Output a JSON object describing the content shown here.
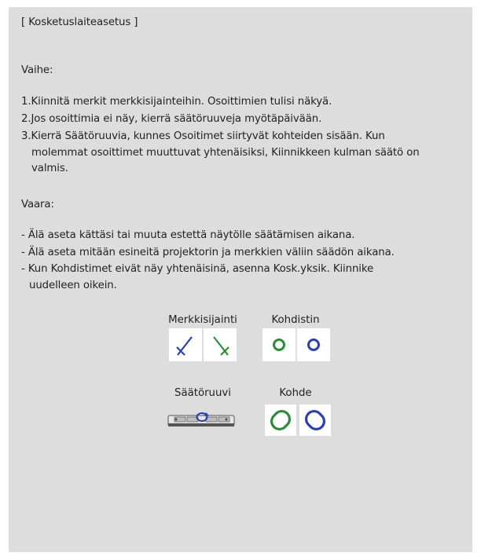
{
  "dialog": {
    "title": "[ Kosketuslaiteasetus ]",
    "steps_heading": "Vaihe:",
    "steps": [
      "1.Kiinnitä merkit merkkisijainteihin. Osoittimien tulisi näkyä.",
      "2.Jos osoittimia ei näy, kierrä säätöruuveja myötäpäivään.",
      "3.Kierrä Säätöruuvia, kunnes Osoitimet siirtyvät kohteiden sisään. Kun",
      "molemmat osoittimet muuttuvat yhtenäisiksi, Kiinnikkeen kulman säätö on",
      "valmis."
    ],
    "warning_heading": "Vaara:",
    "warnings": [
      "- Älä aseta kättäsi tai muuta estettä näytölle säätämisen aikana.",
      "- Älä aseta mitään esineitä projektorin ja merkkien väliin säädön aikana.",
      "- Kun Kohdistimet eivät näy yhtenäisinä, asenna Kosk.yksik. Kiinnike",
      "uudelleen oikein."
    ]
  },
  "legend": {
    "marker_position_label": "Merkkisijainti",
    "pointer_label": "Kohdistin",
    "adjust_screw_label": "Säätöruuvi",
    "target_label": "Kohde"
  },
  "colors": {
    "green": "#2e8b3a",
    "blue": "#2a3fb0",
    "panel": "#dddddd"
  }
}
